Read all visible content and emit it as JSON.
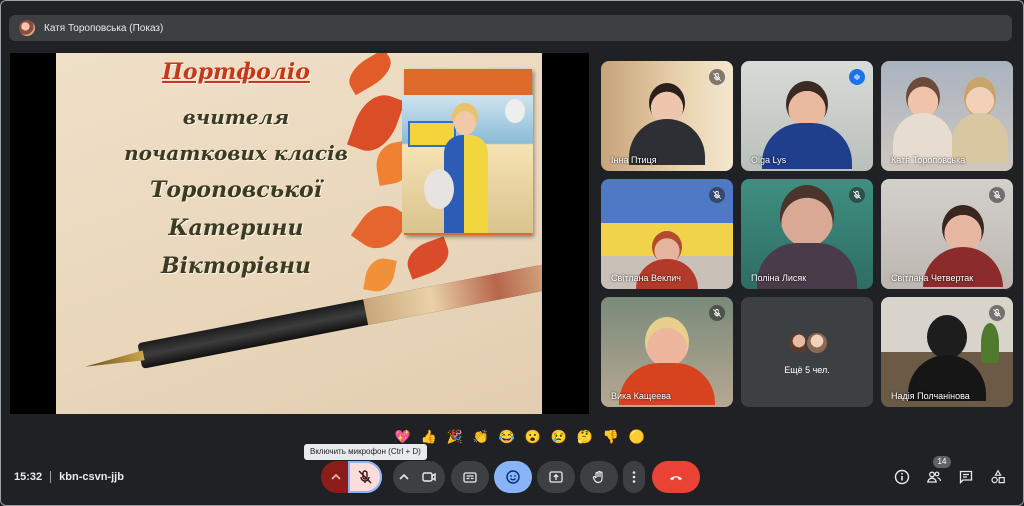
{
  "presenter": {
    "name": "Катя Тороповська (Показ)"
  },
  "slide": {
    "title": "Портфоліо",
    "lines": [
      "вчителя",
      "початкових класів",
      "Тороповської",
      "Катерини",
      "Вікторівни"
    ]
  },
  "participants": [
    {
      "name": "Інна Птиця",
      "status": "muted"
    },
    {
      "name": "Olga Lys",
      "status": "speaking"
    },
    {
      "name": "Катя Тороповська",
      "status": "none"
    },
    {
      "name": "Світлана Веклич",
      "status": "muted"
    },
    {
      "name": "Поліна Лисяк",
      "status": "muted"
    },
    {
      "name": "Світлана Четвертак",
      "status": "muted"
    },
    {
      "name": "Вика Кащеева",
      "status": "muted"
    },
    {
      "name": "Надія Полчанінова",
      "status": "muted"
    }
  ],
  "more": {
    "label": "Ещё 5 чел."
  },
  "reactions": [
    "💖",
    "👍",
    "🎉",
    "👏",
    "😂",
    "😮",
    "😢",
    "🤔",
    "👎",
    "🟡"
  ],
  "tooltip": "Включить микрофон (Ctrl + D)",
  "meeting": {
    "time": "15:32",
    "code": "kbn-csvn-jjb"
  },
  "people_count": "14",
  "colors": {
    "end_call": "#ea4335",
    "active_blue": "#8ab4f8",
    "mic_off_bg": "#f9dedc",
    "background": "#202124"
  }
}
